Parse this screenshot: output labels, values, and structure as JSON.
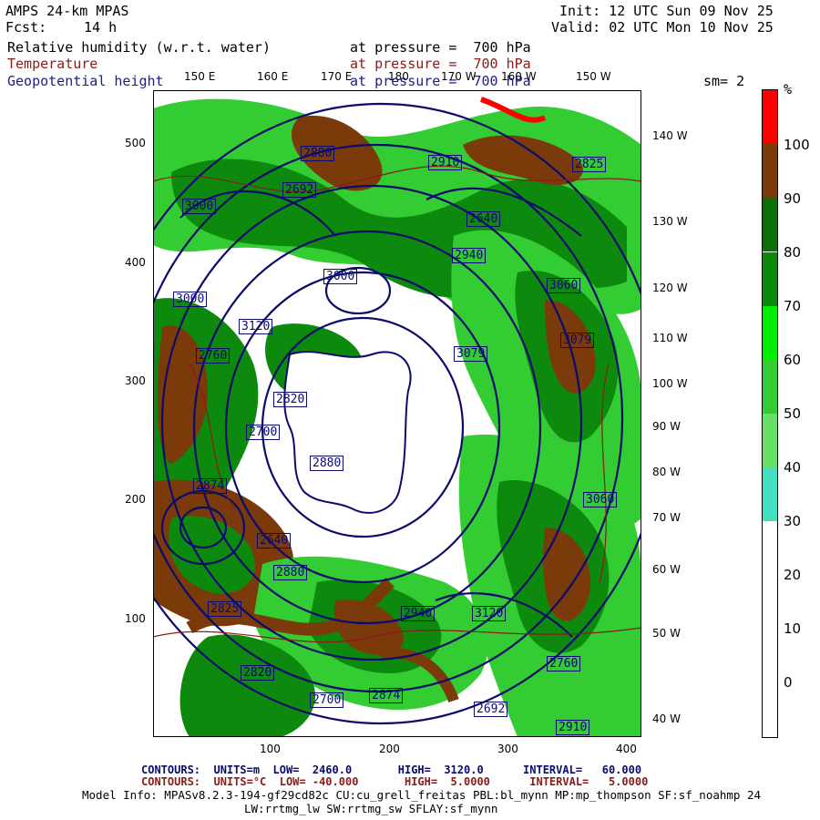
{
  "header": {
    "model": "AMPS 24-km MPAS",
    "fcst_label": "Fcst:",
    "fcst_value": "14 h",
    "init": "Init: 12 UTC Sun 09 Nov 25",
    "valid": "Valid: 02 UTC Mon 10 Nov 25"
  },
  "fields": [
    {
      "name": "Relative humidity (w.r.t. water)",
      "level": "at pressure =  700 hPa",
      "color": "#000000"
    },
    {
      "name": "Temperature",
      "level": "at pressure =  700 hPa",
      "color": "#8b1a1a"
    },
    {
      "name": "Geopotential height",
      "level": "at pressure =  700 hPa",
      "color": "#1c1c8c"
    }
  ],
  "smoothing": "sm= 2",
  "map": {
    "top_lon_labels": [
      "150 E",
      "160 E",
      "170 E",
      "180",
      "170 W",
      "160 W",
      "150 W"
    ],
    "right_lon_labels": [
      "140 W",
      "130 W",
      "120 W",
      "110 W",
      "100 W",
      "90 W",
      "80 W",
      "70 W",
      "60 W",
      "50 W",
      "40 W"
    ],
    "y_ticks": [
      "500",
      "400",
      "300",
      "200",
      "100"
    ],
    "x_ticks": [
      "100",
      "200",
      "300",
      "400"
    ],
    "height_labels": [
      "3000",
      "2880",
      "2640",
      "2940",
      "2825",
      "3120",
      "2760",
      "2820",
      "2700",
      "2874",
      "2692",
      "2910",
      "3060",
      "3079"
    ],
    "colors": {
      "humid_low": "#33cc33",
      "humid_mid": "#0d8a0d",
      "humid_high": "#1e6e1e",
      "saturated": "#7a3a0a",
      "land": "#ffffff",
      "contour": "#0b0b6e",
      "isotherm": "#8b1a1a"
    }
  },
  "colorbar": {
    "unit": "%",
    "labels": [
      "100",
      "90",
      "80",
      "70",
      "60",
      "50",
      "40",
      "30",
      "20",
      "10",
      "0"
    ],
    "segments": [
      {
        "from": 100,
        "color": "#ff0000"
      },
      {
        "from": 90,
        "color": "#7a3a0a"
      },
      {
        "from": 80,
        "color": "#0a6e0a"
      },
      {
        "from": 70,
        "color": "#0d8a0d"
      },
      {
        "from": 60,
        "color": "#00ee00"
      },
      {
        "from": 50,
        "color": "#33cc33"
      },
      {
        "from": 40,
        "color": "#66e066"
      },
      {
        "from": 30,
        "color": "#40e0c0"
      },
      {
        "from": 0,
        "color": "#ffffff"
      }
    ]
  },
  "footer": {
    "contours1": "CONTOURS:  UNITS=m  LOW=  2460.0       HIGH=  3120.0      INTERVAL=   60.000",
    "contours2": "CONTOURS:  UNITS=°C  LOW= -40.000       HIGH=  5.0000      INTERVAL=   5.0000",
    "model_info": "Model Info: MPASv8.2.3-194-gf29cd82c CU:cu_grell_freitas PBL:bl_mynn MP:mp_thompson SF:sf_noahmp 24",
    "model_info2": "LW:rrtmg_lw SW:rrtmg_sw SFLAY:sf_mynn"
  }
}
